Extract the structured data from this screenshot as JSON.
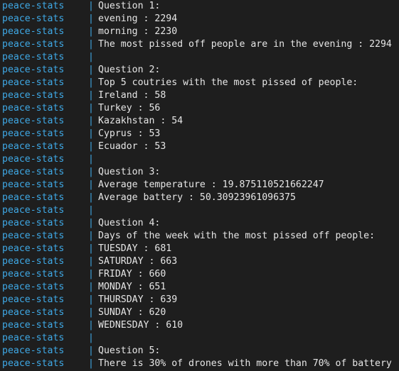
{
  "log": {
    "prefix": "peace-stats",
    "separator": "|",
    "lines": [
      "Question 1:",
      "evening : 2294",
      "morning : 2230",
      "The most pissed off people are in the evening : 2294",
      "",
      "Question 2:",
      "Top 5 coutries with the most pissed of people:",
      "Ireland : 58",
      "Turkey : 56",
      "Kazakhstan : 54",
      "Cyprus : 53",
      "Ecuador : 53",
      "",
      "Question 3:",
      "Average temperature : 19.875110521662247",
      "Average battery : 50.30923961096375",
      "",
      "Question 4:",
      "Days of the week with the most pissed off people:",
      "TUESDAY : 681",
      "SATURDAY : 663",
      "FRIDAY : 660",
      "MONDAY : 651",
      "THURSDAY : 639",
      "SUNDAY : 620",
      "WEDNESDAY : 610",
      "",
      "Question 5:",
      "There is 30% of drones with more than 70% of battery"
    ]
  },
  "colors": {
    "background": "#1e1e1e",
    "prefix": "#3fa9e6",
    "text": "#e6e6e6"
  }
}
